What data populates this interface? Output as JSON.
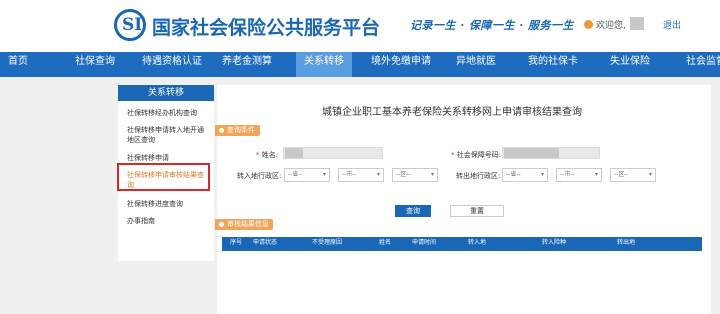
{
  "header": {
    "logo_text": "SI",
    "site_title": "国家社会保险公共服务平台",
    "slogan": "记录一生 · 保障一生 · 服务一生",
    "welcome": "欢迎您,",
    "logout": "退出"
  },
  "nav": {
    "items": [
      {
        "label": "首页"
      },
      {
        "label": "社保查询"
      },
      {
        "label": "待遇资格认证"
      },
      {
        "label": "养老金测算"
      },
      {
        "label": "关系转移",
        "active": true
      },
      {
        "label": "境外免缴申请"
      },
      {
        "label": "异地就医"
      },
      {
        "label": "我的社保卡"
      },
      {
        "label": "失业保险"
      },
      {
        "label": "社会监督"
      }
    ]
  },
  "sidebar": {
    "title": "关系转移",
    "items": [
      {
        "label": "社保转移经办机构查询"
      },
      {
        "label": "社保转移申请转入地开通地区查询"
      },
      {
        "label": "社保转移申请"
      },
      {
        "label": "社保转移申请审核结果查询",
        "active": true
      },
      {
        "label": "社保转移进度查询"
      },
      {
        "label": "办事指南"
      }
    ]
  },
  "main": {
    "title": "城镇企业职工基本养老保险关系转移网上申请审核结果查询",
    "query_section": "查询条件",
    "name_label": "姓名:",
    "ssn_label": "社会保障号码:",
    "transfer_in_label": "转入地行政区:",
    "transfer_out_label": "转出地行政区:",
    "select_province": "--省--",
    "select_city": "--市--",
    "select_district": "--区--",
    "query_button": "查询",
    "reset_button": "重置",
    "result_section": "审核结果信息",
    "columns": [
      "序号",
      "申请状态",
      "不受理原因",
      "姓名",
      "申请时间",
      "转入地",
      "转入险种",
      "转出地"
    ]
  },
  "colors": {
    "brand_blue": "#1a67b6",
    "nav_blue": "#1e6cc0",
    "section_orange": "#f2a45a",
    "highlight_red": "#d62828"
  }
}
